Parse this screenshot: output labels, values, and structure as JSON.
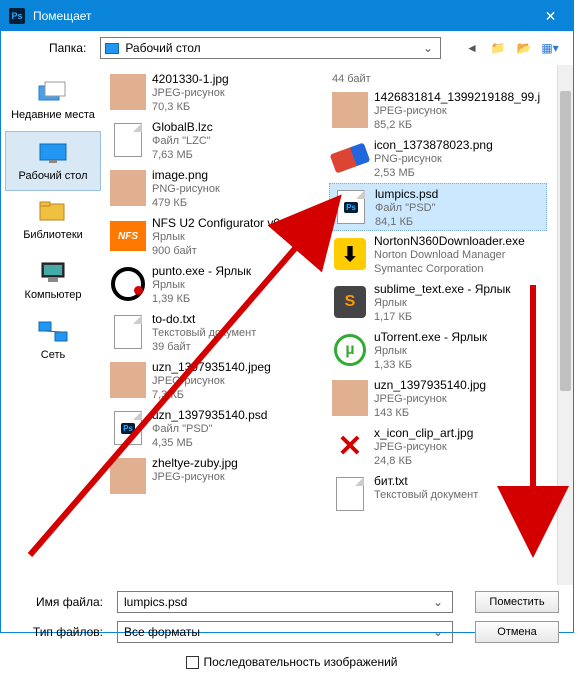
{
  "window": {
    "title": "Помещает",
    "close": "✕"
  },
  "toolbar": {
    "folder_label": "Папка:",
    "folder_value": "Рабочий стол"
  },
  "sidebar": [
    {
      "label": "Недавние места"
    },
    {
      "label": "Рабочий стол"
    },
    {
      "label": "Библиотеки"
    },
    {
      "label": "Компьютер"
    },
    {
      "label": "Сеть"
    }
  ],
  "files_left": [
    {
      "name": "4201330-1.jpg",
      "type": "JPEG-рисунок",
      "size": "70,3 КБ",
      "icon": "photo"
    },
    {
      "name": "GlobalB.lzc",
      "type": "Файл \"LZC\"",
      "size": "7,63 МБ",
      "icon": "doc"
    },
    {
      "name": "image.png",
      "type": "PNG-рисунок",
      "size": "479 КБ",
      "icon": "photo"
    },
    {
      "name": "NFS U2 Configurator v0.9",
      "type": "Ярлык",
      "size": "900 байт",
      "icon": "nfs"
    },
    {
      "name": "punto.exe - Ярлык",
      "type": "Ярлык",
      "size": "1,39 КБ",
      "icon": "punto"
    },
    {
      "name": "to-do.txt",
      "type": "Текстовый документ",
      "size": "39 байт",
      "icon": "doc"
    },
    {
      "name": "uzn_1397935140.jpeg",
      "type": "JPEG-рисунок",
      "size": "7,3 КБ",
      "icon": "photo"
    },
    {
      "name": "uzn_1397935140.psd",
      "type": "Файл \"PSD\"",
      "size": "4,35 МБ",
      "icon": "psd"
    },
    {
      "name": "zheltye-zuby.jpg",
      "type": "JPEG-рисунок",
      "size": "",
      "icon": "photo"
    }
  ],
  "files_right": [
    {
      "name": "44 байт",
      "type": "",
      "size": "",
      "icon": "none"
    },
    {
      "name": "1426831814_1399219188_99.j",
      "type": "JPEG-рисунок",
      "size": "85,2 КБ",
      "icon": "photo"
    },
    {
      "name": "icon_1373878023.png",
      "type": "PNG-рисунок",
      "size": "2,53 МБ",
      "icon": "eraser"
    },
    {
      "name": "lumpics.psd",
      "type": "Файл \"PSD\"",
      "size": "84,1 КБ",
      "icon": "psd",
      "selected": true
    },
    {
      "name": "NortonN360Downloader.exe",
      "type": "Norton Download Manager",
      "size": "Symantec Corporation",
      "icon": "dl"
    },
    {
      "name": "sublime_text.exe - Ярлык",
      "type": "Ярлык",
      "size": "1,17 КБ",
      "icon": "subl"
    },
    {
      "name": "uTorrent.exe - Ярлык",
      "type": "Ярлык",
      "size": "1,33 КБ",
      "icon": "ut"
    },
    {
      "name": "uzn_1397935140.jpg",
      "type": "JPEG-рисунок",
      "size": "143 КБ",
      "icon": "photo"
    },
    {
      "name": "x_icon_clip_art.jpg",
      "type": "JPEG-рисунок",
      "size": "24,8 КБ",
      "icon": "x"
    },
    {
      "name": "бит.txt",
      "type": "Текстовый документ",
      "size": "",
      "icon": "doc"
    }
  ],
  "bottom": {
    "fname_label": "Имя файла:",
    "fname_value": "lumpics.psd",
    "ftype_label": "Тип файлов:",
    "ftype_value": "Все форматы",
    "place_btn": "Поместить",
    "cancel_btn": "Отмена",
    "seq_label": "Последовательность изображений"
  }
}
